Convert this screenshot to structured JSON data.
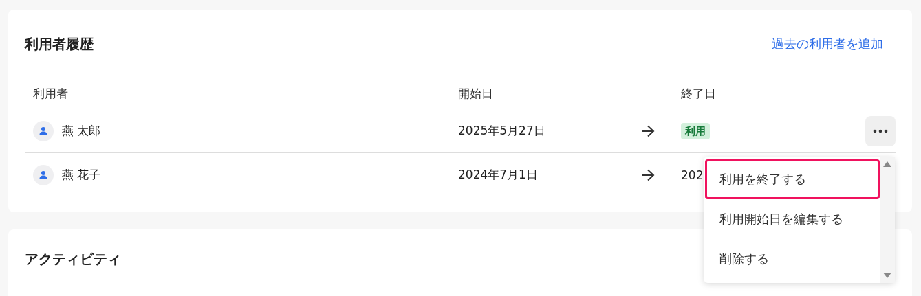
{
  "history_card": {
    "title": "利用者履歴",
    "add_link": "過去の利用者を追加",
    "columns": [
      "利用者",
      "開始日",
      "終了日"
    ],
    "rows": [
      {
        "name": "燕 太郎",
        "start": "2025年5月27日",
        "kind": "badge",
        "end": "利用",
        "more_button": true
      },
      {
        "name": "燕 花子",
        "start": "2024年7月1日",
        "kind": "text",
        "end": "202",
        "more_button": false
      }
    ]
  },
  "menu": {
    "items": [
      {
        "label": "利用を終了する",
        "selected": true
      },
      {
        "label": "利用開始日を編集する",
        "selected": false
      },
      {
        "label": "削除する",
        "selected": false
      }
    ]
  },
  "activity_card": {
    "title": "アクティビティ"
  }
}
